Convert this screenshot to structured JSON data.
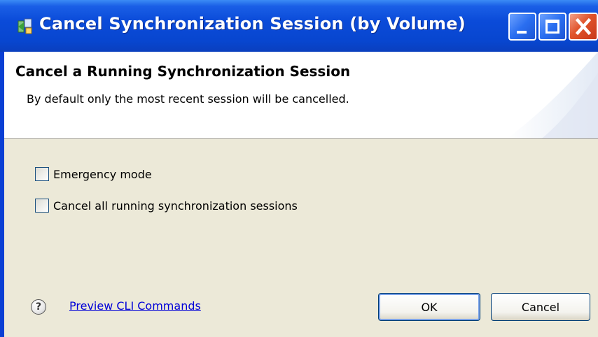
{
  "window": {
    "title": "Cancel Synchronization Session (by Volume)",
    "icons": {
      "app": "sync-app-icon",
      "minimize": "minimize-icon",
      "maximize": "maximize-icon",
      "close": "close-icon"
    }
  },
  "header": {
    "title": "Cancel a Running Synchronization Session",
    "description": "By default only the most recent session will be cancelled."
  },
  "options": [
    {
      "label": "Emergency mode",
      "checked": false
    },
    {
      "label": "Cancel all running synchronization sessions",
      "checked": false
    }
  ],
  "footer": {
    "help_icon": "help-icon",
    "help_glyph": "?",
    "link_label": "Preview CLI Commands",
    "ok_label": "OK",
    "cancel_label": "Cancel"
  },
  "colors": {
    "titlebar": "#0846cf",
    "body_bg": "#ece9d8",
    "link": "#0000d8",
    "close_button": "#e0532a"
  }
}
